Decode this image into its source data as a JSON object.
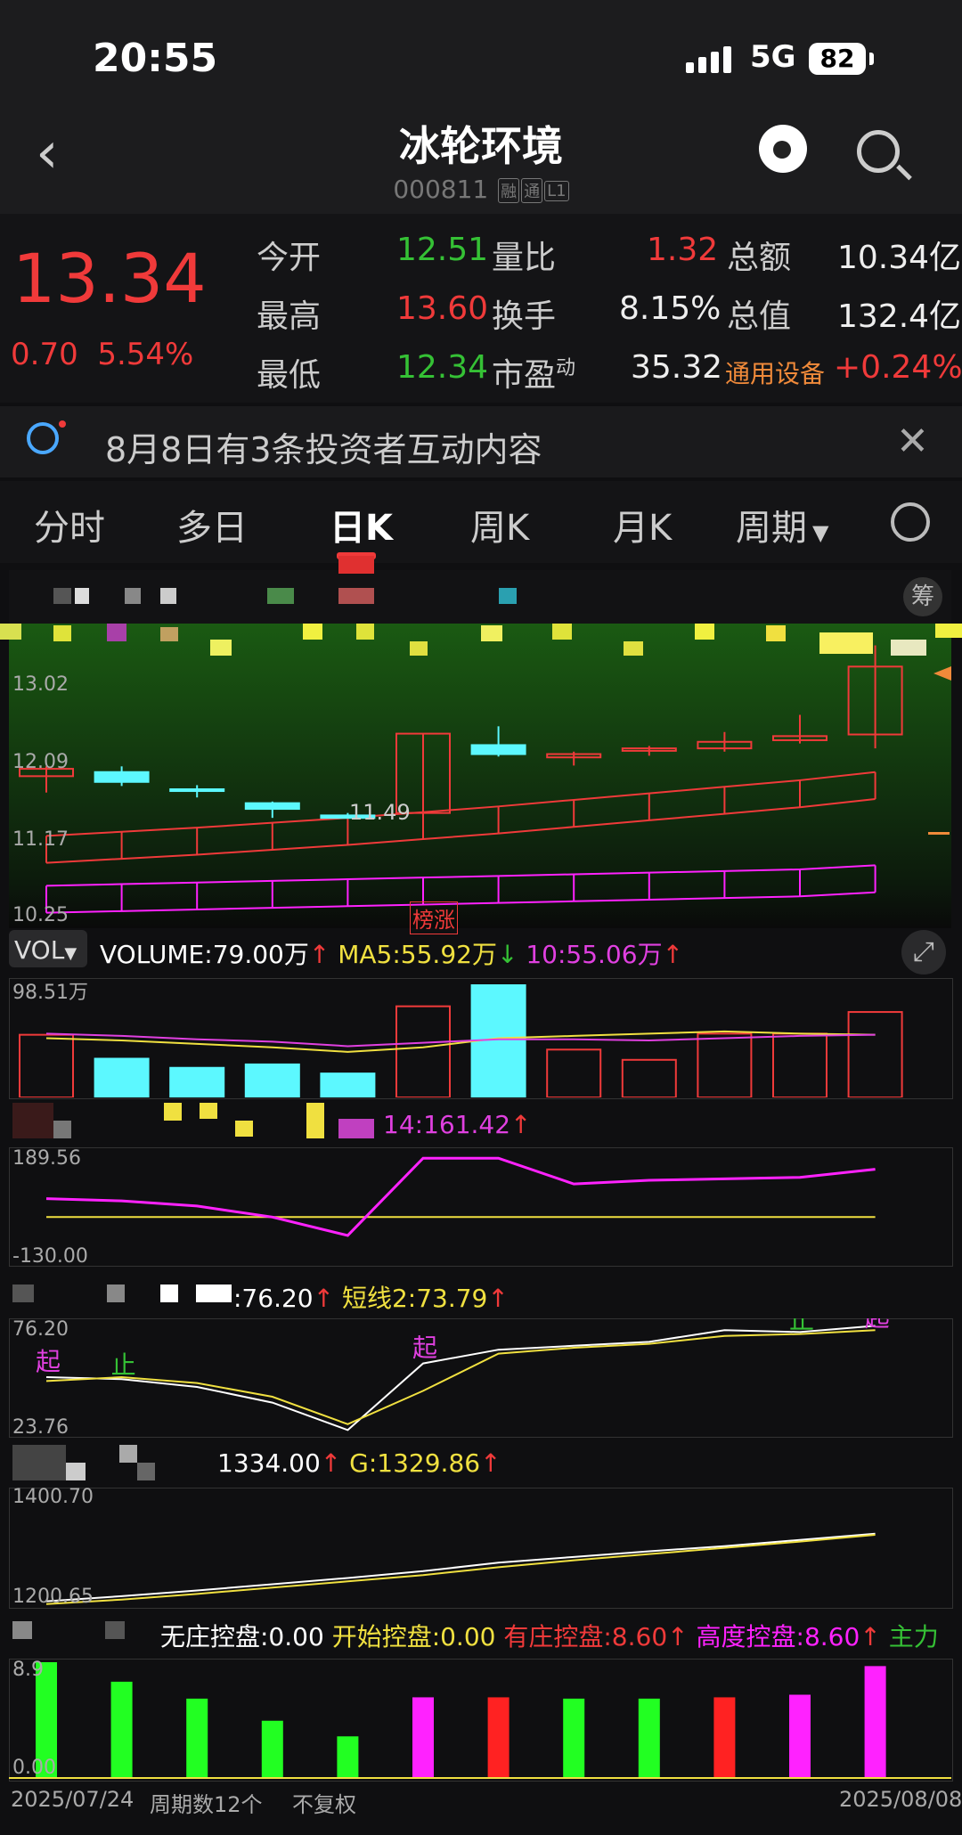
{
  "status": {
    "time": "20:55",
    "network": "5G",
    "battery": "82"
  },
  "header": {
    "title": "冰轮环境",
    "code": "000811",
    "tags": [
      "融",
      "通",
      "L1"
    ]
  },
  "quote": {
    "price": "13.34",
    "change": "0.70",
    "change_pct": "5.54%",
    "rows": [
      {
        "l1": "今开",
        "v1": "12.51",
        "l2": "量比",
        "v2": "1.32",
        "l3": "总额",
        "v3": "10.34亿"
      },
      {
        "l1": "最高",
        "v1": "13.60",
        "l2": "换手",
        "v2": "8.15%",
        "l3": "总值",
        "v3": "132.4亿"
      },
      {
        "l1": "最低",
        "v1": "12.34",
        "l2": "市盈",
        "v2": "35.32",
        "l3": "通用设备",
        "v3": "+0.24%"
      }
    ],
    "pe_sup": "动"
  },
  "notice": {
    "text": "8月8日有3条投资者互动内容"
  },
  "tabs": [
    "分时",
    "多日",
    "日K",
    "周K",
    "月K",
    "周期"
  ],
  "colors": {
    "up": "#f03a3a",
    "down": "#5cf8ff",
    "ma5": "#f0e040",
    "ma10": "#e040e0"
  },
  "kline": {
    "badge": "筹",
    "yticks": [
      "13.02",
      "12.09",
      "11.17",
      "10.25"
    ],
    "annotation": "11.49",
    "tag": "榜涨",
    "ymin": 10.25,
    "ymax": 13.3,
    "candles": [
      {
        "o": 12.09,
        "c": 12.0,
        "h": 12.12,
        "l": 11.8,
        "up": true
      },
      {
        "o": 12.05,
        "c": 11.93,
        "h": 12.12,
        "l": 11.88,
        "up": false
      },
      {
        "o": 11.84,
        "c": 11.84,
        "h": 11.89,
        "l": 11.74,
        "up": false
      },
      {
        "o": 11.67,
        "c": 11.6,
        "h": 11.69,
        "l": 11.49,
        "up": false
      },
      {
        "o": 11.52,
        "c": 11.49,
        "h": 11.55,
        "l": 11.49,
        "up": false
      },
      {
        "o": 11.55,
        "c": 12.52,
        "h": 12.52,
        "l": 11.55,
        "up": true
      },
      {
        "o": 12.38,
        "c": 12.27,
        "h": 12.61,
        "l": 12.24,
        "up": false
      },
      {
        "o": 12.23,
        "c": 12.27,
        "h": 12.3,
        "l": 12.13,
        "up": true
      },
      {
        "o": 12.31,
        "c": 12.34,
        "h": 12.37,
        "l": 12.25,
        "up": true
      },
      {
        "o": 12.34,
        "c": 12.42,
        "h": 12.54,
        "l": 12.3,
        "up": true
      },
      {
        "o": 12.44,
        "c": 12.49,
        "h": 12.75,
        "l": 12.4,
        "up": true
      },
      {
        "o": 12.51,
        "c": 13.34,
        "h": 13.6,
        "l": 12.34,
        "up": true
      }
    ],
    "band_upper": [
      11.27,
      11.32,
      11.37,
      11.43,
      11.49,
      11.56,
      11.63,
      11.71,
      11.79,
      11.87,
      11.95,
      12.05
    ],
    "band_lower": [
      10.66,
      10.68,
      10.7,
      10.72,
      10.74,
      10.76,
      10.78,
      10.8,
      10.82,
      10.84,
      10.86,
      10.91
    ]
  },
  "volume": {
    "selector": "VOL",
    "line": [
      {
        "k": "VOLUME:",
        "v": "79.00万",
        "c": "#ffffff"
      },
      {
        "k": "MA5:",
        "v": "55.92万",
        "c": "#f0e040"
      },
      {
        "k": "10:",
        "v": "55.06万",
        "c": "#e040e0"
      }
    ],
    "ytick": "98.51万",
    "max": 98.51,
    "bars": [
      55,
      34,
      26,
      29,
      21,
      80,
      98.5,
      42,
      33,
      56,
      56,
      75
    ],
    "ma5": [
      52,
      50,
      47,
      44,
      40,
      44,
      52,
      54,
      56,
      58,
      56,
      55
    ],
    "ma10": [
      56,
      54,
      51,
      49,
      45,
      48,
      51,
      51,
      50,
      52,
      54,
      55
    ]
  },
  "ind1": {
    "label": "14:161.42",
    "yticks": [
      "189.56",
      "-130.00"
    ],
    "min": -130,
    "max": 189.56,
    "line": [
      50,
      44,
      30,
      0,
      -50,
      160,
      160,
      90,
      100,
      104,
      108,
      130
    ],
    "flat": 0
  },
  "ind2": {
    "label_a": ":76.20",
    "label_b": "短线2:73.79",
    "yticks": [
      "76.20",
      "23.76"
    ],
    "min": 20,
    "max": 80,
    "white": [
      50,
      49,
      45,
      37,
      23,
      57,
      64,
      66,
      68,
      74,
      73,
      76.2
    ],
    "yellow": [
      48,
      50,
      47,
      40,
      26,
      43,
      62,
      65,
      67,
      71,
      72,
      74
    ],
    "marks": [
      {
        "i": 0,
        "t": "起",
        "c": "#e040e0",
        "dy": -18
      },
      {
        "i": 1,
        "t": "止",
        "c": "#35c135",
        "dy": -16
      },
      {
        "i": 5,
        "t": "起",
        "c": "#e040e0",
        "dy": -18
      },
      {
        "i": 10,
        "t": "止",
        "c": "#35c135",
        "dy": -14
      },
      {
        "i": 11,
        "t": "起",
        "c": "#e040e0",
        "dy": -10
      }
    ]
  },
  "ind3": {
    "label_a": "1334.00",
    "label_b": "G:1329.86",
    "yticks": [
      "1400.70",
      "1200.65"
    ],
    "min": 1195,
    "max": 1405,
    "white": [
      1205,
      1214,
      1224,
      1235,
      1246,
      1258,
      1273,
      1283,
      1293,
      1302,
      1313,
      1324
    ],
    "yellow": [
      1200,
      1208,
      1218,
      1229,
      1240,
      1251,
      1265,
      1277,
      1288,
      1299,
      1310,
      1322
    ]
  },
  "ind4": {
    "items": [
      {
        "t": "无庄控盘:0.00",
        "c": "#ffffff"
      },
      {
        "t": "开始控盘:0.00",
        "c": "#f0e040"
      },
      {
        "t": "有庄控盘:8.60",
        "c": "#f03a3a"
      },
      {
        "t": "高度控盘:8.60",
        "c": "#ff22ff"
      },
      {
        "t": "主力",
        "c": "#35c135"
      }
    ],
    "yticks": [
      "8.9",
      "0.00"
    ],
    "max": 8.9,
    "bars": [
      {
        "v": 8.9,
        "c": "#22ff22"
      },
      {
        "v": 7.4,
        "c": "#22ff22"
      },
      {
        "v": 6.1,
        "c": "#22ff22"
      },
      {
        "v": 4.4,
        "c": "#22ff22"
      },
      {
        "v": 3.2,
        "c": "#22ff22"
      },
      {
        "v": 6.2,
        "c": "#ff22ff"
      },
      {
        "v": 6.2,
        "c": "#ff2222"
      },
      {
        "v": 6.1,
        "c": "#22ff22"
      },
      {
        "v": 6.1,
        "c": "#22ff22"
      },
      {
        "v": 6.2,
        "c": "#ff2222"
      },
      {
        "v": 6.4,
        "c": "#ff22ff"
      },
      {
        "v": 8.6,
        "c": "#ff22ff"
      }
    ]
  },
  "footer": {
    "start": "2025/07/24",
    "count": "周期数12个",
    "adj": "不复权",
    "end": "2025/08/08"
  }
}
